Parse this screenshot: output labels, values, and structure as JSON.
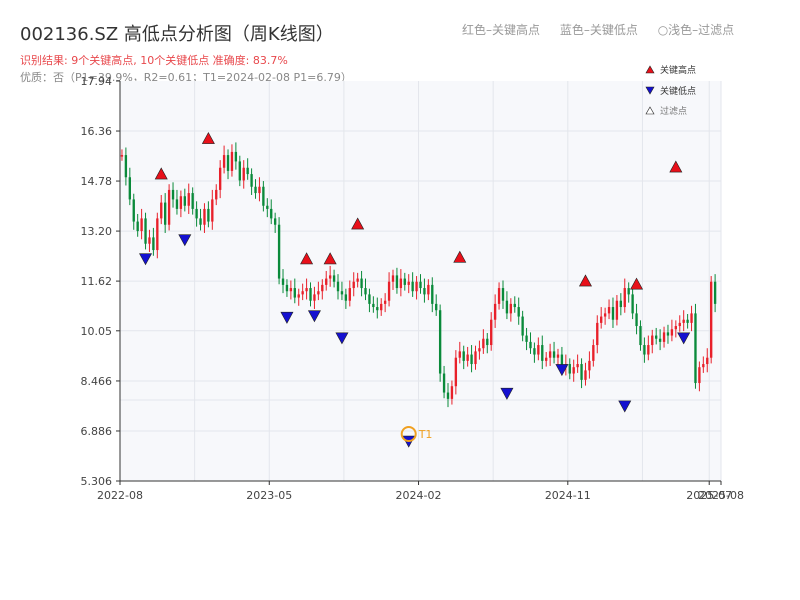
{
  "header": {
    "title": "002136.SZ 高低点分析图（周K线图）",
    "result": "识别结果: 9个关键高点, 10个关键低点  准确度: 83.7%",
    "quality": "优质：否（P1=39.9%，R2=0.61；T1=2024-02-08 P1=6.79）"
  },
  "top_legend": {
    "red": "红色–关键高点",
    "blue": "蓝色–关键低点",
    "light": "○浅色–过滤点"
  },
  "legend": {
    "high": "关键高点",
    "low": "关键低点",
    "filtered": "过滤点"
  },
  "annotation": {
    "t1_label": "T1"
  },
  "colors": {
    "up": "#e8202a",
    "down": "#0a8a3a",
    "high_marker": "#e8101a",
    "low_marker": "#1410d0",
    "t1_ring": "#f0a020",
    "plot_bg": "#f7f8fb",
    "grid": "#e3e6ec"
  },
  "chart_data": {
    "type": "candlestick",
    "ylim": [
      5.306,
      17.94
    ],
    "y_ticks": [
      "5.306",
      "6.886",
      "8.466",
      "10.05",
      "11.62",
      "13.20",
      "14.78",
      "16.36",
      "17.94"
    ],
    "x_ticks": [
      {
        "label": "2022-08",
        "week": 0
      },
      {
        "label": "2023-05",
        "week": 38
      },
      {
        "label": "2024-02",
        "week": 76
      },
      {
        "label": "2024-11",
        "week": 114
      },
      {
        "label": "2025-07",
        "week": 150
      },
      {
        "label": "2025-08",
        "week": 153
      }
    ],
    "weeks": 153,
    "close": [
      15.6,
      14.9,
      14.2,
      13.5,
      13.2,
      13.6,
      12.8,
      13.0,
      12.6,
      13.6,
      14.1,
      13.4,
      14.5,
      14.2,
      13.9,
      14.3,
      14.0,
      14.4,
      13.9,
      13.6,
      13.4,
      13.9,
      13.5,
      14.2,
      14.5,
      15.2,
      15.6,
      15.1,
      15.7,
      15.4,
      14.8,
      15.2,
      15.0,
      14.6,
      14.4,
      14.6,
      14.0,
      13.9,
      13.6,
      13.4,
      11.7,
      11.5,
      11.3,
      11.4,
      11.1,
      11.2,
      11.3,
      11.4,
      11.0,
      11.2,
      11.3,
      11.5,
      11.7,
      11.8,
      11.6,
      11.3,
      11.2,
      11.0,
      11.4,
      11.6,
      11.7,
      11.4,
      11.2,
      10.9,
      10.8,
      10.7,
      10.9,
      11.0,
      11.6,
      11.8,
      11.4,
      11.7,
      11.5,
      11.6,
      11.3,
      11.6,
      11.4,
      11.2,
      11.5,
      10.9,
      10.7,
      8.7,
      8.1,
      7.9,
      8.3,
      9.2,
      9.4,
      9.1,
      9.3,
      9.0,
      9.4,
      9.5,
      9.8,
      9.6,
      10.4,
      10.9,
      11.4,
      11.0,
      10.6,
      10.9,
      10.8,
      10.5,
      9.9,
      9.7,
      9.5,
      9.3,
      9.6,
      9.1,
      9.2,
      9.4,
      9.2,
      9.3,
      8.9,
      9.0,
      8.7,
      8.9,
      9.0,
      8.5,
      8.8,
      9.1,
      9.6,
      10.3,
      10.5,
      10.6,
      10.8,
      10.4,
      11.0,
      10.8,
      11.4,
      11.2,
      10.6,
      10.2,
      9.6,
      9.3,
      9.6,
      9.9,
      9.8,
      9.7,
      10.0,
      9.9,
      10.1,
      10.2,
      10.3,
      10.4,
      10.3,
      10.6,
      8.4,
      8.9,
      9.0,
      9.2,
      11.6,
      10.9
    ],
    "key_highs": [
      {
        "week": 10,
        "value": 14.78
      },
      {
        "week": 22,
        "value": 15.9
      },
      {
        "week": 47,
        "value": 12.1
      },
      {
        "week": 53,
        "value": 12.1
      },
      {
        "week": 60,
        "value": 13.2
      },
      {
        "week": 86,
        "value": 12.15
      },
      {
        "week": 118,
        "value": 11.4
      },
      {
        "week": 131,
        "value": 11.3
      },
      {
        "week": 141,
        "value": 15.0
      }
    ],
    "key_lows": [
      {
        "week": 6,
        "value": 12.55
      },
      {
        "week": 16,
        "value": 13.15
      },
      {
        "week": 42,
        "value": 10.7
      },
      {
        "week": 49,
        "value": 10.75
      },
      {
        "week": 56,
        "value": 10.05
      },
      {
        "week": 73,
        "value": 6.79
      },
      {
        "week": 98,
        "value": 8.3
      },
      {
        "week": 112,
        "value": 9.05
      },
      {
        "week": 128,
        "value": 7.9
      },
      {
        "week": 143,
        "value": 10.05
      }
    ],
    "t1": {
      "week": 73,
      "value": 6.79,
      "date": "2024-02-08"
    }
  }
}
